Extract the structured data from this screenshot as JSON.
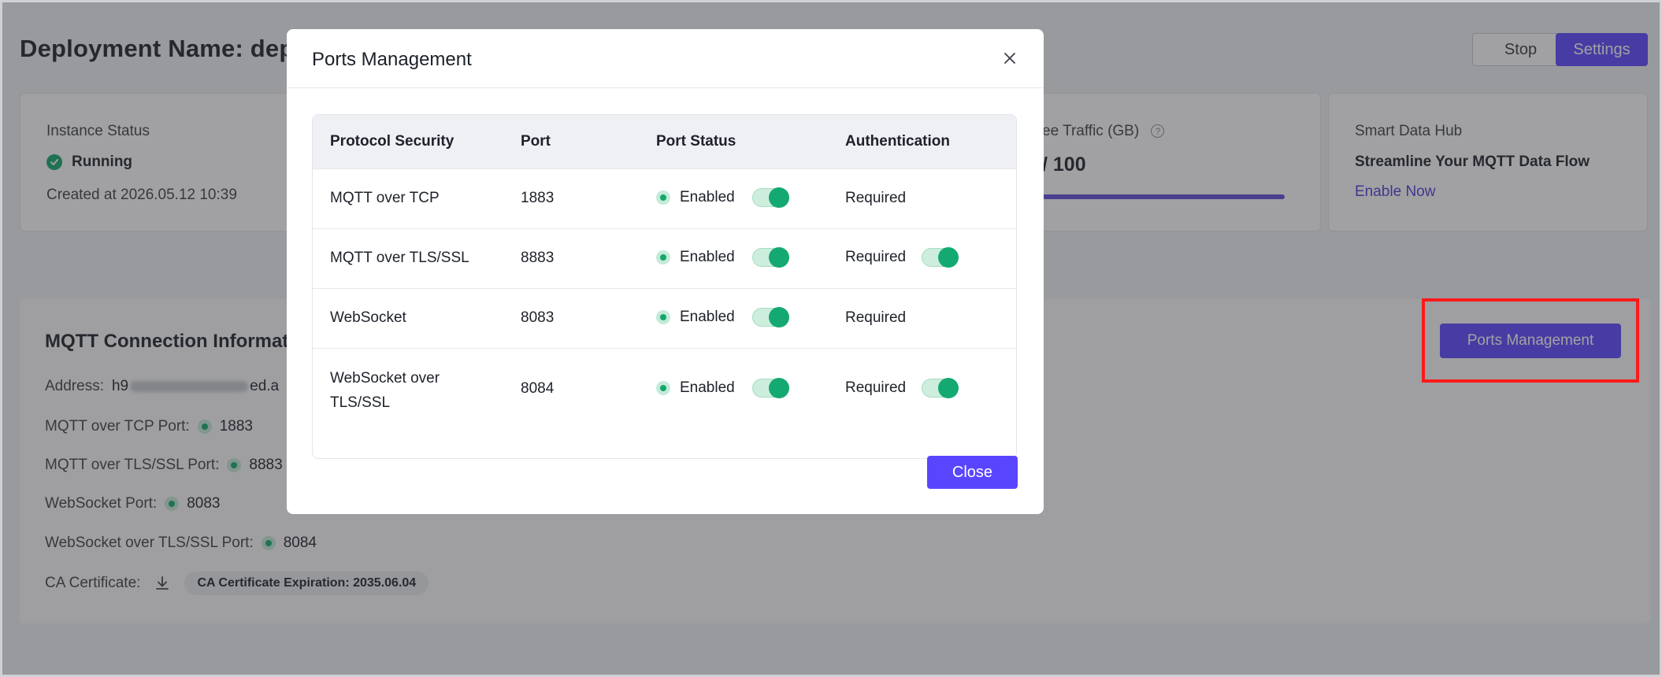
{
  "page": {
    "title": "Deployment Name: dep",
    "stop_label": "Stop",
    "settings_label": "Settings"
  },
  "cards": {
    "instance": {
      "label": "Instance Status",
      "status": "Running",
      "created": "Created at 2026.05.12 10:39"
    },
    "traffic": {
      "label": "ee Traffic (GB)",
      "value": "/ 100"
    },
    "hub": {
      "label": "Smart Data Hub",
      "title": "Streamline Your MQTT Data Flow",
      "link": "Enable Now"
    }
  },
  "connection": {
    "title": "MQTT Connection Informati",
    "address_label": "Address:",
    "address_value_start": "h9",
    "address_value_end": "ed.a",
    "rows": [
      {
        "label": "MQTT over TCP Port:",
        "value": "1883"
      },
      {
        "label": "MQTT over TLS/SSL Port:",
        "value": "8883"
      },
      {
        "label": "WebSocket Port:",
        "value": "8083"
      },
      {
        "label": "WebSocket over TLS/SSL Port:",
        "value": "8084"
      }
    ],
    "ca_label": "CA Certificate:",
    "ca_expiration": "CA Certificate Expiration: 2035.06.04",
    "ports_button": "Ports Management"
  },
  "modal": {
    "title": "Ports Management",
    "columns": [
      "Protocol Security",
      "Port",
      "Port Status",
      "Authentication"
    ],
    "rows": [
      {
        "protocol": "MQTT over TCP",
        "port": "1883",
        "status": "Enabled",
        "auth": "Required",
        "status_on": true,
        "auth_toggle": false
      },
      {
        "protocol": "MQTT over TLS/SSL",
        "port": "8883",
        "status": "Enabled",
        "auth": "Required",
        "status_on": true,
        "auth_toggle": true
      },
      {
        "protocol": "WebSocket",
        "port": "8083",
        "status": "Enabled",
        "auth": "Required",
        "status_on": true,
        "auth_toggle": false
      },
      {
        "protocol_line1": "WebSocket over",
        "protocol_line2": "TLS/SSL",
        "port": "8084",
        "status": "Enabled",
        "auth": "Required",
        "status_on": true,
        "auth_toggle": true
      }
    ],
    "close_label": "Close"
  },
  "colors": {
    "accent": "#5a45ff",
    "success": "#12a86a",
    "highlight": "#ff1a1a"
  }
}
